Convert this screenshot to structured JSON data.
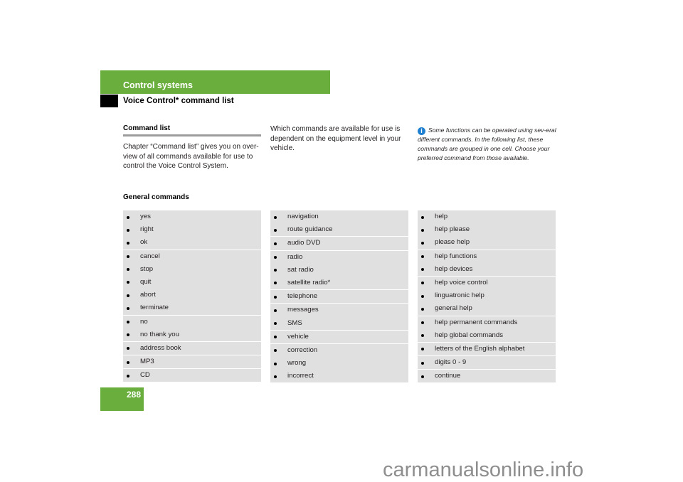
{
  "header": {
    "section": "Control systems",
    "subsection": "Voice Control* command list"
  },
  "page_number": "288",
  "command_list": {
    "title": "Command list",
    "intro": "Chapter “Command list” gives you on over-view of all commands available for use to control the Voice Control System.",
    "availability": "Which commands are available for use is dependent on the equipment level in your vehicle.",
    "note": {
      "icon": "info-icon",
      "text": "Some functions can be operated using sev-eral different commands. In the following list, these commands are grouped in one cell. Choose your preferred command from those available."
    }
  },
  "general_commands": {
    "title": "General commands",
    "columns": [
      {
        "groups": [
          [
            "yes",
            "right",
            "ok"
          ],
          [
            "cancel",
            "stop",
            "quit",
            "abort",
            "terminate"
          ],
          [
            "no",
            "no thank you"
          ],
          [
            "address book"
          ],
          [
            "MP3"
          ],
          [
            "CD"
          ]
        ]
      },
      {
        "groups": [
          [
            "navigation",
            "route guidance"
          ],
          [
            "audio DVD"
          ],
          [
            "radio",
            "sat radio",
            "satellite radio*"
          ],
          [
            "telephone"
          ],
          [
            "messages",
            "SMS"
          ],
          [
            "vehicle"
          ],
          [
            "correction",
            "wrong",
            "incorrect"
          ]
        ]
      },
      {
        "groups": [
          [
            "help",
            "help please",
            "please help"
          ],
          [
            "help functions",
            "help devices"
          ],
          [
            "help voice control",
            "linguatronic help",
            "general help"
          ],
          [
            "help permanent commands",
            "help global commands"
          ],
          [
            "letters of the English alphabet"
          ],
          [
            "digits 0 - 9"
          ],
          [
            "continue"
          ]
        ]
      }
    ]
  },
  "watermark": "carmanualsonline.info",
  "colors": {
    "brand_green": "#6aaf3d",
    "table_gray": "#e0e0e0",
    "info_blue": "#1f7fd0"
  }
}
